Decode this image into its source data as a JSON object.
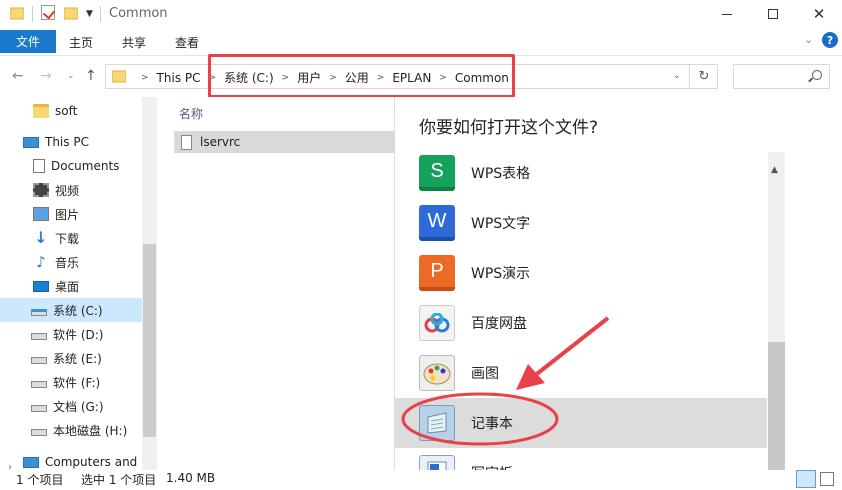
{
  "window": {
    "title": "Common",
    "controls": [
      "minimize",
      "maximize",
      "close"
    ]
  },
  "ribbon": {
    "file_tab": "文件",
    "tabs": [
      "主页",
      "共享",
      "查看"
    ],
    "help": "?"
  },
  "address": {
    "breadcrumb": [
      "This PC",
      "系统 (C:)",
      "用户",
      "公用",
      "EPLAN",
      "Common"
    ],
    "search_placeholder": ""
  },
  "sidebar": {
    "items": [
      {
        "label": "soft",
        "icon": "folder-icon"
      },
      {
        "label": "This PC",
        "icon": "computer-icon"
      },
      {
        "label": "Documents",
        "icon": "documents-icon"
      },
      {
        "label": "视频",
        "icon": "video-icon"
      },
      {
        "label": "图片",
        "icon": "pictures-icon"
      },
      {
        "label": "下载",
        "icon": "download-icon"
      },
      {
        "label": "音乐",
        "icon": "music-icon"
      },
      {
        "label": "桌面",
        "icon": "desktop-icon"
      },
      {
        "label": "系统 (C:)",
        "icon": "system-drive-icon",
        "selected": true
      },
      {
        "label": "软件 (D:)",
        "icon": "drive-icon"
      },
      {
        "label": "系统 (E:)",
        "icon": "drive-icon"
      },
      {
        "label": "软件 (F:)",
        "icon": "drive-icon"
      },
      {
        "label": "文档 (G:)",
        "icon": "drive-icon"
      },
      {
        "label": "本地磁盘 (H:)",
        "icon": "drive-icon"
      },
      {
        "label": "Computers and I",
        "icon": "network-computer-icon"
      }
    ]
  },
  "filelist": {
    "column_name": "名称",
    "files": [
      {
        "name": "lservrc",
        "icon": "file-icon"
      }
    ]
  },
  "dialog": {
    "title": "你要如何打开这个文件?",
    "apps": [
      {
        "label": "WPS表格",
        "glyph": "S",
        "icon": "wps-spreadsheet-icon"
      },
      {
        "label": "WPS文字",
        "glyph": "W",
        "icon": "wps-writer-icon"
      },
      {
        "label": "WPS演示",
        "glyph": "P",
        "icon": "wps-presentation-icon"
      },
      {
        "label": "百度网盘",
        "glyph": "",
        "icon": "baidu-netdisk-icon"
      },
      {
        "label": "画图",
        "glyph": "",
        "icon": "paint-icon"
      },
      {
        "label": "记事本",
        "glyph": "",
        "icon": "notepad-icon",
        "selected": true
      },
      {
        "label": "写字板",
        "glyph": "",
        "icon": "wordpad-icon"
      }
    ]
  },
  "statusbar": {
    "count": "1 个项目",
    "selected": "选中 1 个项目",
    "size": "1.40 MB"
  },
  "annotation_color": "#e8414a"
}
